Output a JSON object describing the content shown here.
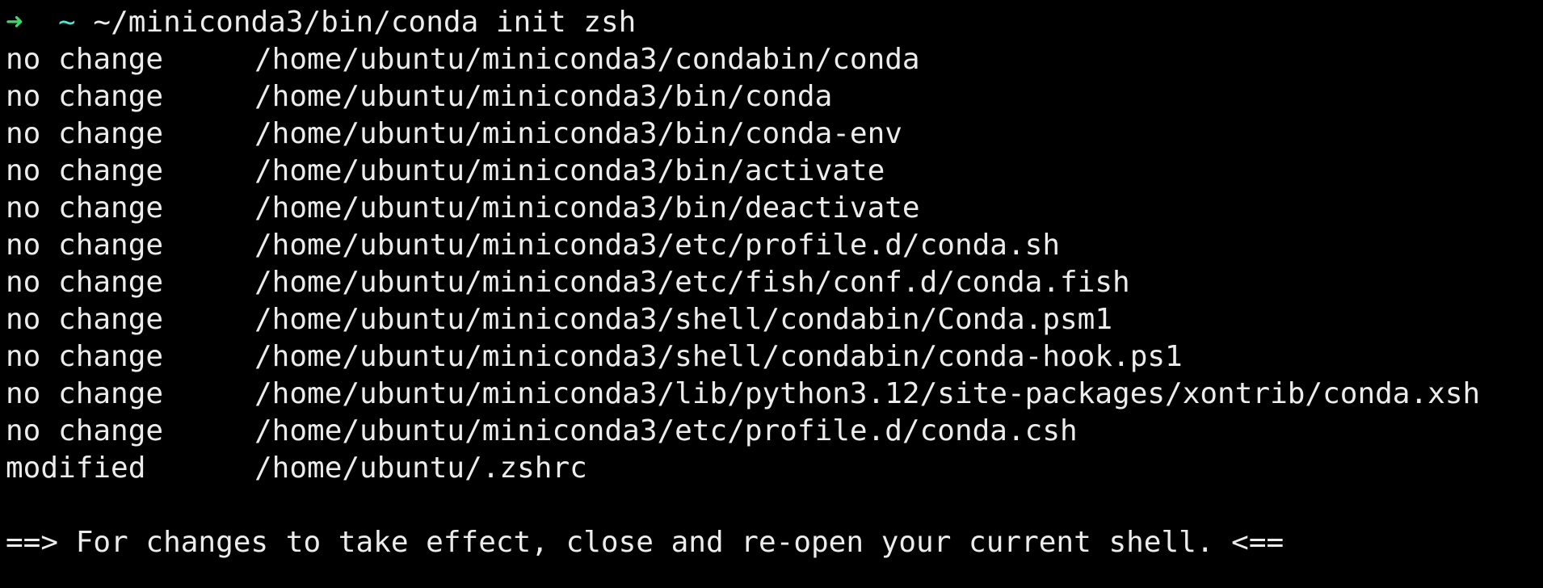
{
  "terminal": {
    "prompt": {
      "arrow": "➜",
      "cwd": "~",
      "command": "~/miniconda3/bin/conda init zsh"
    },
    "rows": [
      {
        "status": "no change",
        "path": "/home/ubuntu/miniconda3/condabin/conda"
      },
      {
        "status": "no change",
        "path": "/home/ubuntu/miniconda3/bin/conda"
      },
      {
        "status": "no change",
        "path": "/home/ubuntu/miniconda3/bin/conda-env"
      },
      {
        "status": "no change",
        "path": "/home/ubuntu/miniconda3/bin/activate"
      },
      {
        "status": "no change",
        "path": "/home/ubuntu/miniconda3/bin/deactivate"
      },
      {
        "status": "no change",
        "path": "/home/ubuntu/miniconda3/etc/profile.d/conda.sh"
      },
      {
        "status": "no change",
        "path": "/home/ubuntu/miniconda3/etc/fish/conf.d/conda.fish"
      },
      {
        "status": "no change",
        "path": "/home/ubuntu/miniconda3/shell/condabin/Conda.psm1"
      },
      {
        "status": "no change",
        "path": "/home/ubuntu/miniconda3/shell/condabin/conda-hook.ps1"
      },
      {
        "status": "no change",
        "path": "/home/ubuntu/miniconda3/lib/python3.12/site-packages/xontrib/conda.xsh"
      },
      {
        "status": "no change",
        "path": "/home/ubuntu/miniconda3/etc/profile.d/conda.csh"
      },
      {
        "status": "modified",
        "path": "/home/ubuntu/.zshrc"
      }
    ],
    "notice": "==> For changes to take effect, close and re-open your current shell. <==",
    "colors": {
      "background": "#000000",
      "text": "#ececec",
      "prompt_arrow": "#3fd76a",
      "prompt_cwd": "#4fe3d6"
    }
  }
}
